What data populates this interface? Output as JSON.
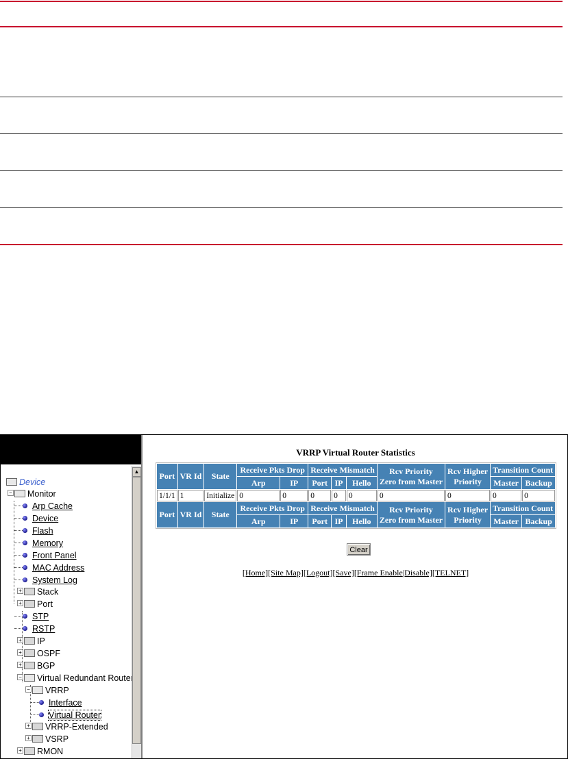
{
  "tree": {
    "items": [
      {
        "label": "Device",
        "style": "italic-blue"
      },
      {
        "label": "Monitor"
      },
      {
        "label": "Arp Cache"
      },
      {
        "label": "Device"
      },
      {
        "label": "Flash"
      },
      {
        "label": "Memory"
      },
      {
        "label": "Front Panel"
      },
      {
        "label": "MAC Address"
      },
      {
        "label": "System Log"
      },
      {
        "label": "Stack"
      },
      {
        "label": "Port"
      },
      {
        "label": "STP"
      },
      {
        "label": "RSTP"
      },
      {
        "label": "IP"
      },
      {
        "label": "OSPF"
      },
      {
        "label": "BGP"
      },
      {
        "label": "Virtual Redundant Router"
      },
      {
        "label": "VRRP"
      },
      {
        "label": "Interface"
      },
      {
        "label": "Virtual Router"
      },
      {
        "label": "VRRP-Extended"
      },
      {
        "label": "VSRP"
      },
      {
        "label": "RMON"
      }
    ]
  },
  "stats": {
    "title": "VRRP Virtual Router Statistics",
    "headers": {
      "port": "Port",
      "vrid": "VR Id",
      "state": "State",
      "rx_drop": "Receive Pkts Drop",
      "rx_mismatch": "Receive Mismatch",
      "rcv_priority": "Rcv Priority",
      "rcv_priority2": "Zero from Master",
      "rcv_higher": "Rcv Higher",
      "rcv_higher2": "Priority",
      "transition": "Transition Count",
      "arp": "Arp",
      "ip": "IP",
      "mm_port": "Port",
      "mm_ip": "IP",
      "hello": "Hello",
      "master": "Master",
      "backup": "Backup"
    },
    "row": {
      "port": "1/1/1",
      "vrid": "1",
      "state": "Initialize",
      "arp": "0",
      "ip": "0",
      "mm_port": "0",
      "mm_ip": "0",
      "hello": "0",
      "rcv_priority": "0",
      "rcv_higher": "0",
      "master": "0",
      "backup": "0"
    }
  },
  "clear_label": "Clear",
  "nav": {
    "home": "[Home]",
    "site_map": "[Site Map]",
    "logout": "[Logout]",
    "save": "[Save]",
    "frame_enable": "[Frame Enable",
    "disable": "|Disable]",
    "telnet": "[TELNET]"
  }
}
